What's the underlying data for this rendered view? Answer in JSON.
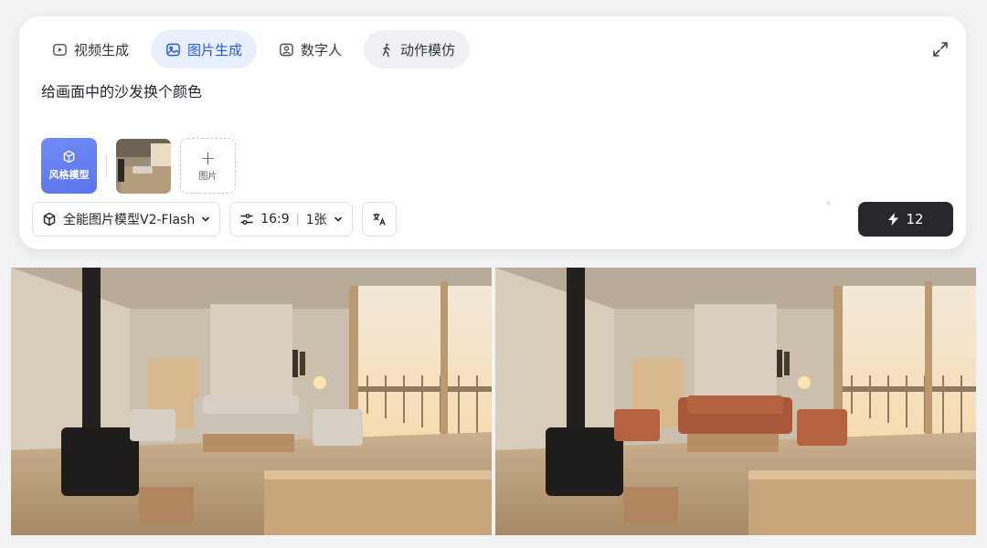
{
  "tabs": [
    {
      "label": "视频生成",
      "icon": "video-icon",
      "active": false
    },
    {
      "label": "图片生成",
      "icon": "image-icon",
      "active": true
    },
    {
      "label": "数字人",
      "icon": "digital-human-icon",
      "active": false
    },
    {
      "label": "动作模仿",
      "icon": "walking-person-icon",
      "active": false
    }
  ],
  "prompt": {
    "text": "给画面中的沙发换个颜色"
  },
  "assets": {
    "style_model_label": "风格模型",
    "add_image_label": "图片",
    "add_symbol": "+"
  },
  "toolbar": {
    "model": "全能图片模型V2-Flash",
    "ratio": "16:9",
    "divider": "|",
    "count": "1张"
  },
  "generate": {
    "credits": "12"
  },
  "results": [
    {
      "name": "original-image",
      "sofa_color": "#cbc3b6"
    },
    {
      "name": "edited-image",
      "sofa_color": "#a8583a"
    }
  ],
  "colors": {
    "accent": "#2a5bd7",
    "active_tab_bg": "#e8efff",
    "generate_bg": "#26282c"
  }
}
